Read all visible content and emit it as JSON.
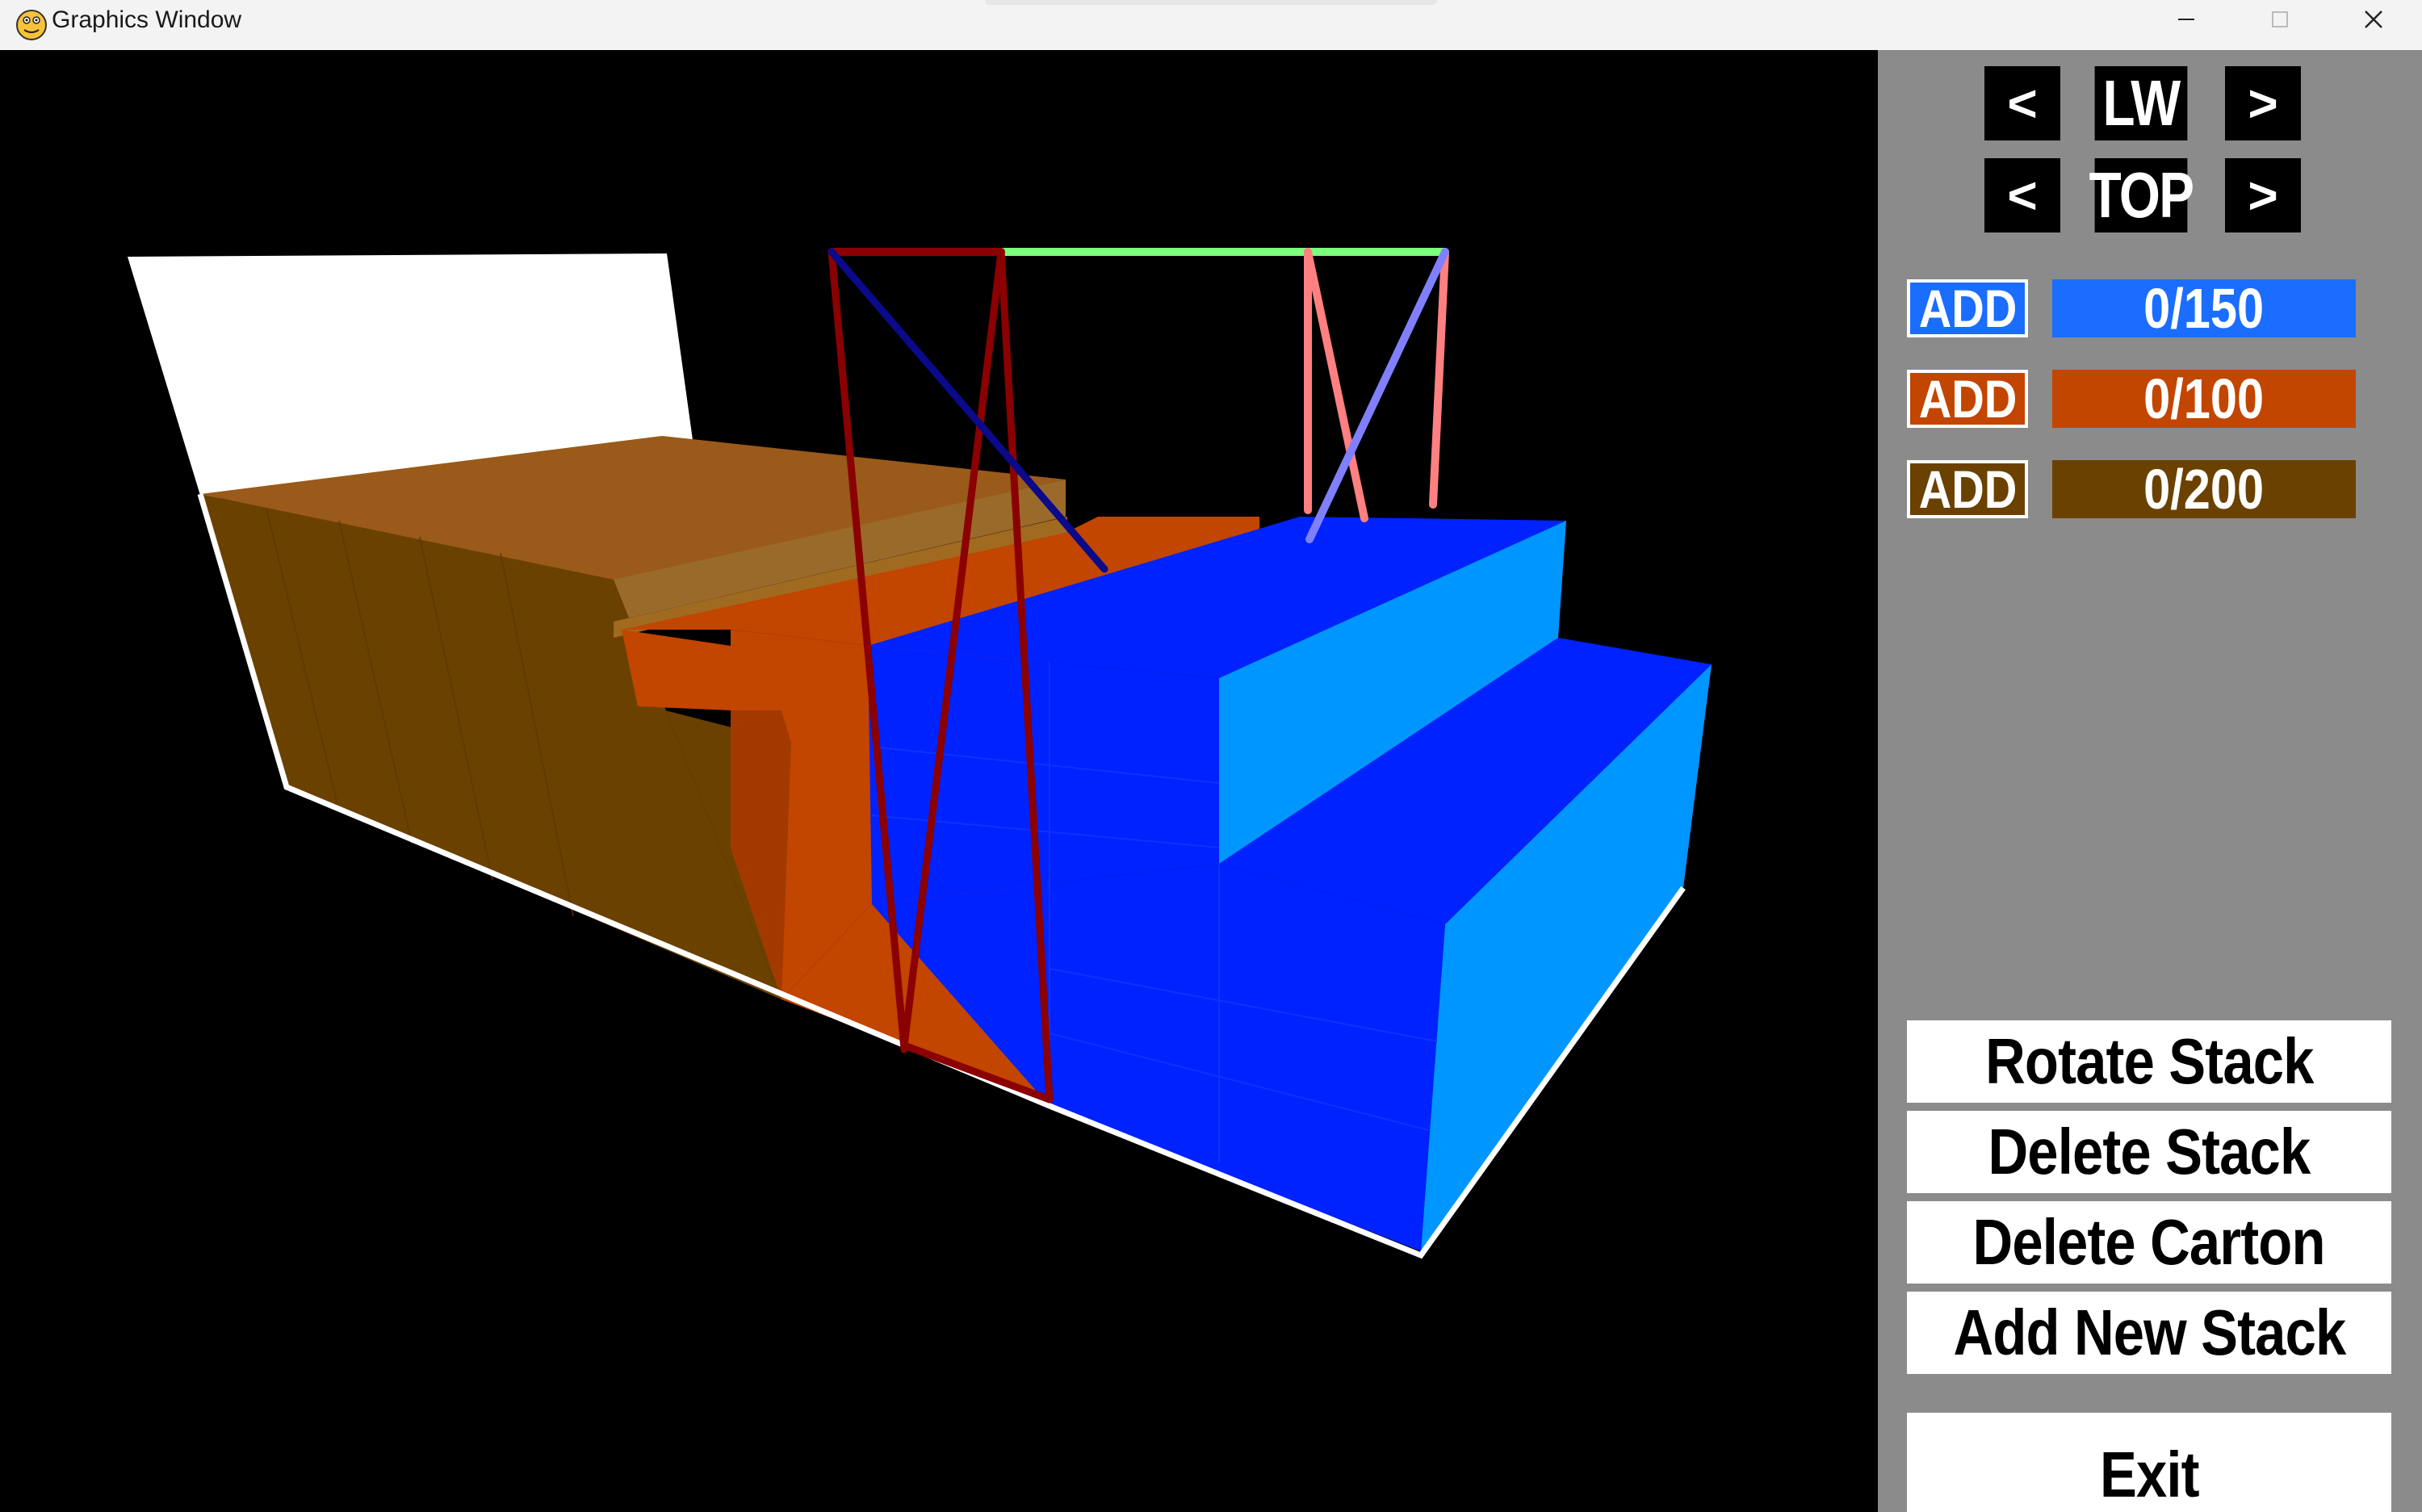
{
  "window": {
    "title": "Graphics Window",
    "controls": {
      "minimize_icon": "minimize-icon",
      "maximize_icon": "maximize-icon",
      "close_icon": "close-icon"
    }
  },
  "panel": {
    "view_rows": [
      {
        "prev": "<",
        "label": "LW",
        "next": ">"
      },
      {
        "prev": "<",
        "label": "TOP",
        "next": ">"
      }
    ],
    "cartons": [
      {
        "add_label": "ADD",
        "count": "0/150",
        "color": "#1a6dff"
      },
      {
        "add_label": "ADD",
        "count": "0/100",
        "color": "#c24500"
      },
      {
        "add_label": "ADD",
        "count": "0/200",
        "color": "#6b4100"
      }
    ],
    "actions": {
      "rotate": "Rotate Stack",
      "delete_stack": "Delete Stack",
      "delete_carton": "Delete Carton",
      "add_stack": "Add New Stack",
      "exit": "Exit"
    },
    "background": "#8b8b8b"
  },
  "scene": {
    "background": "#000000",
    "colors": {
      "light_blue": "#0096ff",
      "blue": "#0022ff",
      "orange": "#c24500",
      "brown": "#6b4100",
      "tan_top": "#9a6a1a",
      "floor_edge": "#ffffff",
      "axis_red": "#8b0000",
      "axis_green": "#7cff7c",
      "axis_pink": "#ff8080"
    }
  }
}
